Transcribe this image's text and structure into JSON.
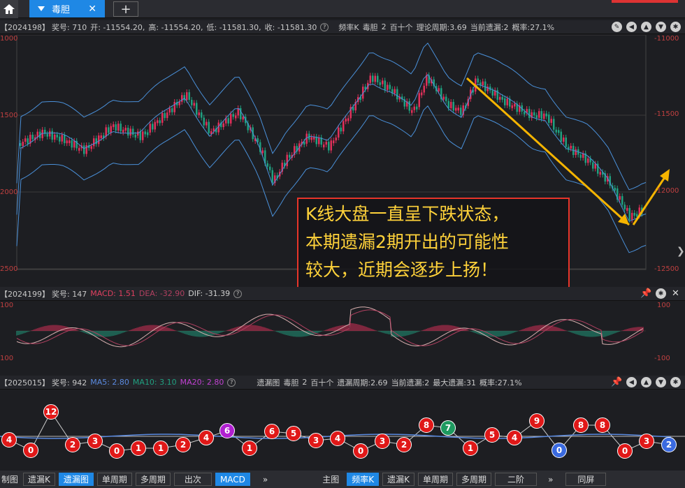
{
  "tabs": {
    "home_icon": "home-icon",
    "active_label": "毒胆",
    "close": "✕",
    "add": "+"
  },
  "kline_header": {
    "period": "【2024198】",
    "award": "奖号: 710",
    "open": "开: -11554.20,",
    "high": "高: -11554.20,",
    "low": "低: -11581.30,",
    "close": "收: -11581.30",
    "help": "?",
    "freq": "频率K",
    "name": "毒胆",
    "n": "2",
    "digit": "百十个",
    "theory": "理论周期:3.69",
    "current": "当前遗漏:2",
    "prob": "概率:27.1%"
  },
  "kline_axis": {
    "left": [
      "1000",
      "1500",
      "2000",
      "2500"
    ],
    "right": [
      "-11000",
      "-11500",
      "-12000",
      "-12500"
    ]
  },
  "callout": {
    "line1": "K线大盘一直呈下跌状态，",
    "line2": "本期遗漏2期开出的可能性",
    "line3": "较大，近期会逐步上扬！"
  },
  "macd_header": {
    "period": "【2024199】",
    "award": "奖号: 147",
    "macd": "MACD: 1.51",
    "dea": "DEA: -32.90",
    "dif": "DIF: -31.39",
    "help": "?"
  },
  "macd_axis": {
    "left": [
      "100",
      "100"
    ],
    "right": [
      "100",
      "-100"
    ]
  },
  "miss_header": {
    "period": "【2025015】",
    "award": "奖号: 942",
    "ma5": "MA5: 2.80",
    "ma10": "MA10: 3.10",
    "ma20": "MA20: 2.80",
    "help": "?",
    "chart": "遗漏图",
    "name": "毒胆",
    "n": "2",
    "digit": "百十个",
    "cycle": "遗漏周期:2.69",
    "current": "当前遗漏:2",
    "max": "最大遗漏:31",
    "prob": "概率:27.1%"
  },
  "balls": [
    {
      "v": "4",
      "c": "#e01818"
    },
    {
      "v": "0",
      "c": "#e01818"
    },
    {
      "v": "12",
      "c": "#e01818"
    },
    {
      "v": "2",
      "c": "#e01818"
    },
    {
      "v": "3",
      "c": "#e01818"
    },
    {
      "v": "0",
      "c": "#e01818"
    },
    {
      "v": "1",
      "c": "#e01818"
    },
    {
      "v": "1",
      "c": "#e01818"
    },
    {
      "v": "2",
      "c": "#e01818"
    },
    {
      "v": "4",
      "c": "#e01818"
    },
    {
      "v": "6",
      "c": "#b020d0"
    },
    {
      "v": "1",
      "c": "#e01818"
    },
    {
      "v": "6",
      "c": "#e01818"
    },
    {
      "v": "5",
      "c": "#e01818"
    },
    {
      "v": "3",
      "c": "#e01818"
    },
    {
      "v": "4",
      "c": "#e01818"
    },
    {
      "v": "0",
      "c": "#e01818"
    },
    {
      "v": "3",
      "c": "#e01818"
    },
    {
      "v": "2",
      "c": "#e01818"
    },
    {
      "v": "8",
      "c": "#e01818"
    },
    {
      "v": "7",
      "c": "#1e9a60"
    },
    {
      "v": "1",
      "c": "#e01818"
    },
    {
      "v": "5",
      "c": "#e01818"
    },
    {
      "v": "4",
      "c": "#e01818"
    },
    {
      "v": "9",
      "c": "#e01818"
    },
    {
      "v": "0",
      "c": "#3a6ae0"
    },
    {
      "v": "8",
      "c": "#e01818"
    },
    {
      "v": "8",
      "c": "#e01818"
    },
    {
      "v": "0",
      "c": "#e01818"
    },
    {
      "v": "3",
      "c": "#e01818"
    },
    {
      "v": "2",
      "c": "#3a6ae0"
    }
  ],
  "bottom_left": [
    "制图",
    "遗漏K",
    "遗漏图",
    "单周期",
    "多周期",
    "出次",
    "MACD",
    "»"
  ],
  "bottom_right": [
    "主图",
    "频率K",
    "遗漏K",
    "单周期",
    "多周期",
    "二阶",
    "»",
    "同屏"
  ],
  "colors": {
    "up": "#e0305a",
    "down": "#20a080",
    "band": "#4a90d9",
    "arrow": "#f5b400",
    "accent": "#1f88e5"
  }
}
